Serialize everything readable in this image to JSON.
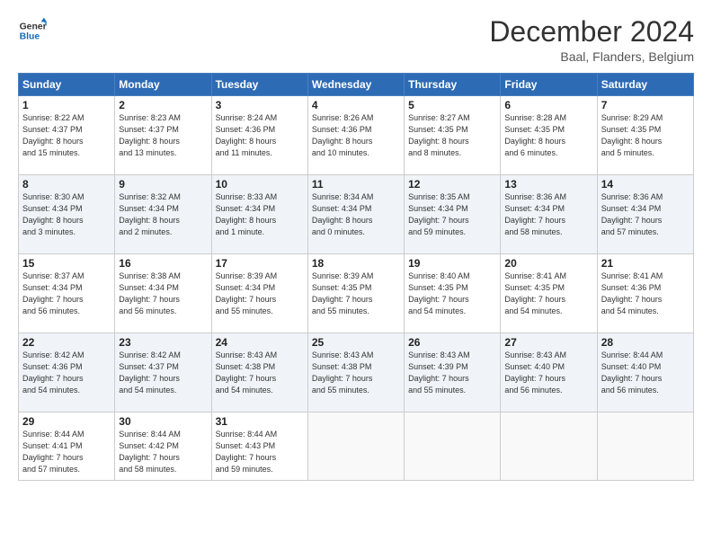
{
  "header": {
    "logo_line1": "General",
    "logo_line2": "Blue",
    "month": "December 2024",
    "location": "Baal, Flanders, Belgium"
  },
  "days_of_week": [
    "Sunday",
    "Monday",
    "Tuesday",
    "Wednesday",
    "Thursday",
    "Friday",
    "Saturday"
  ],
  "weeks": [
    [
      {
        "day": "1",
        "info": "Sunrise: 8:22 AM\nSunset: 4:37 PM\nDaylight: 8 hours\nand 15 minutes."
      },
      {
        "day": "2",
        "info": "Sunrise: 8:23 AM\nSunset: 4:37 PM\nDaylight: 8 hours\nand 13 minutes."
      },
      {
        "day": "3",
        "info": "Sunrise: 8:24 AM\nSunset: 4:36 PM\nDaylight: 8 hours\nand 11 minutes."
      },
      {
        "day": "4",
        "info": "Sunrise: 8:26 AM\nSunset: 4:36 PM\nDaylight: 8 hours\nand 10 minutes."
      },
      {
        "day": "5",
        "info": "Sunrise: 8:27 AM\nSunset: 4:35 PM\nDaylight: 8 hours\nand 8 minutes."
      },
      {
        "day": "6",
        "info": "Sunrise: 8:28 AM\nSunset: 4:35 PM\nDaylight: 8 hours\nand 6 minutes."
      },
      {
        "day": "7",
        "info": "Sunrise: 8:29 AM\nSunset: 4:35 PM\nDaylight: 8 hours\nand 5 minutes."
      }
    ],
    [
      {
        "day": "8",
        "info": "Sunrise: 8:30 AM\nSunset: 4:34 PM\nDaylight: 8 hours\nand 3 minutes."
      },
      {
        "day": "9",
        "info": "Sunrise: 8:32 AM\nSunset: 4:34 PM\nDaylight: 8 hours\nand 2 minutes."
      },
      {
        "day": "10",
        "info": "Sunrise: 8:33 AM\nSunset: 4:34 PM\nDaylight: 8 hours\nand 1 minute."
      },
      {
        "day": "11",
        "info": "Sunrise: 8:34 AM\nSunset: 4:34 PM\nDaylight: 8 hours\nand 0 minutes."
      },
      {
        "day": "12",
        "info": "Sunrise: 8:35 AM\nSunset: 4:34 PM\nDaylight: 7 hours\nand 59 minutes."
      },
      {
        "day": "13",
        "info": "Sunrise: 8:36 AM\nSunset: 4:34 PM\nDaylight: 7 hours\nand 58 minutes."
      },
      {
        "day": "14",
        "info": "Sunrise: 8:36 AM\nSunset: 4:34 PM\nDaylight: 7 hours\nand 57 minutes."
      }
    ],
    [
      {
        "day": "15",
        "info": "Sunrise: 8:37 AM\nSunset: 4:34 PM\nDaylight: 7 hours\nand 56 minutes."
      },
      {
        "day": "16",
        "info": "Sunrise: 8:38 AM\nSunset: 4:34 PM\nDaylight: 7 hours\nand 56 minutes."
      },
      {
        "day": "17",
        "info": "Sunrise: 8:39 AM\nSunset: 4:34 PM\nDaylight: 7 hours\nand 55 minutes."
      },
      {
        "day": "18",
        "info": "Sunrise: 8:39 AM\nSunset: 4:35 PM\nDaylight: 7 hours\nand 55 minutes."
      },
      {
        "day": "19",
        "info": "Sunrise: 8:40 AM\nSunset: 4:35 PM\nDaylight: 7 hours\nand 54 minutes."
      },
      {
        "day": "20",
        "info": "Sunrise: 8:41 AM\nSunset: 4:35 PM\nDaylight: 7 hours\nand 54 minutes."
      },
      {
        "day": "21",
        "info": "Sunrise: 8:41 AM\nSunset: 4:36 PM\nDaylight: 7 hours\nand 54 minutes."
      }
    ],
    [
      {
        "day": "22",
        "info": "Sunrise: 8:42 AM\nSunset: 4:36 PM\nDaylight: 7 hours\nand 54 minutes."
      },
      {
        "day": "23",
        "info": "Sunrise: 8:42 AM\nSunset: 4:37 PM\nDaylight: 7 hours\nand 54 minutes."
      },
      {
        "day": "24",
        "info": "Sunrise: 8:43 AM\nSunset: 4:38 PM\nDaylight: 7 hours\nand 54 minutes."
      },
      {
        "day": "25",
        "info": "Sunrise: 8:43 AM\nSunset: 4:38 PM\nDaylight: 7 hours\nand 55 minutes."
      },
      {
        "day": "26",
        "info": "Sunrise: 8:43 AM\nSunset: 4:39 PM\nDaylight: 7 hours\nand 55 minutes."
      },
      {
        "day": "27",
        "info": "Sunrise: 8:43 AM\nSunset: 4:40 PM\nDaylight: 7 hours\nand 56 minutes."
      },
      {
        "day": "28",
        "info": "Sunrise: 8:44 AM\nSunset: 4:40 PM\nDaylight: 7 hours\nand 56 minutes."
      }
    ],
    [
      {
        "day": "29",
        "info": "Sunrise: 8:44 AM\nSunset: 4:41 PM\nDaylight: 7 hours\nand 57 minutes."
      },
      {
        "day": "30",
        "info": "Sunrise: 8:44 AM\nSunset: 4:42 PM\nDaylight: 7 hours\nand 58 minutes."
      },
      {
        "day": "31",
        "info": "Sunrise: 8:44 AM\nSunset: 4:43 PM\nDaylight: 7 hours\nand 59 minutes."
      },
      {
        "day": "",
        "info": ""
      },
      {
        "day": "",
        "info": ""
      },
      {
        "day": "",
        "info": ""
      },
      {
        "day": "",
        "info": ""
      }
    ]
  ]
}
